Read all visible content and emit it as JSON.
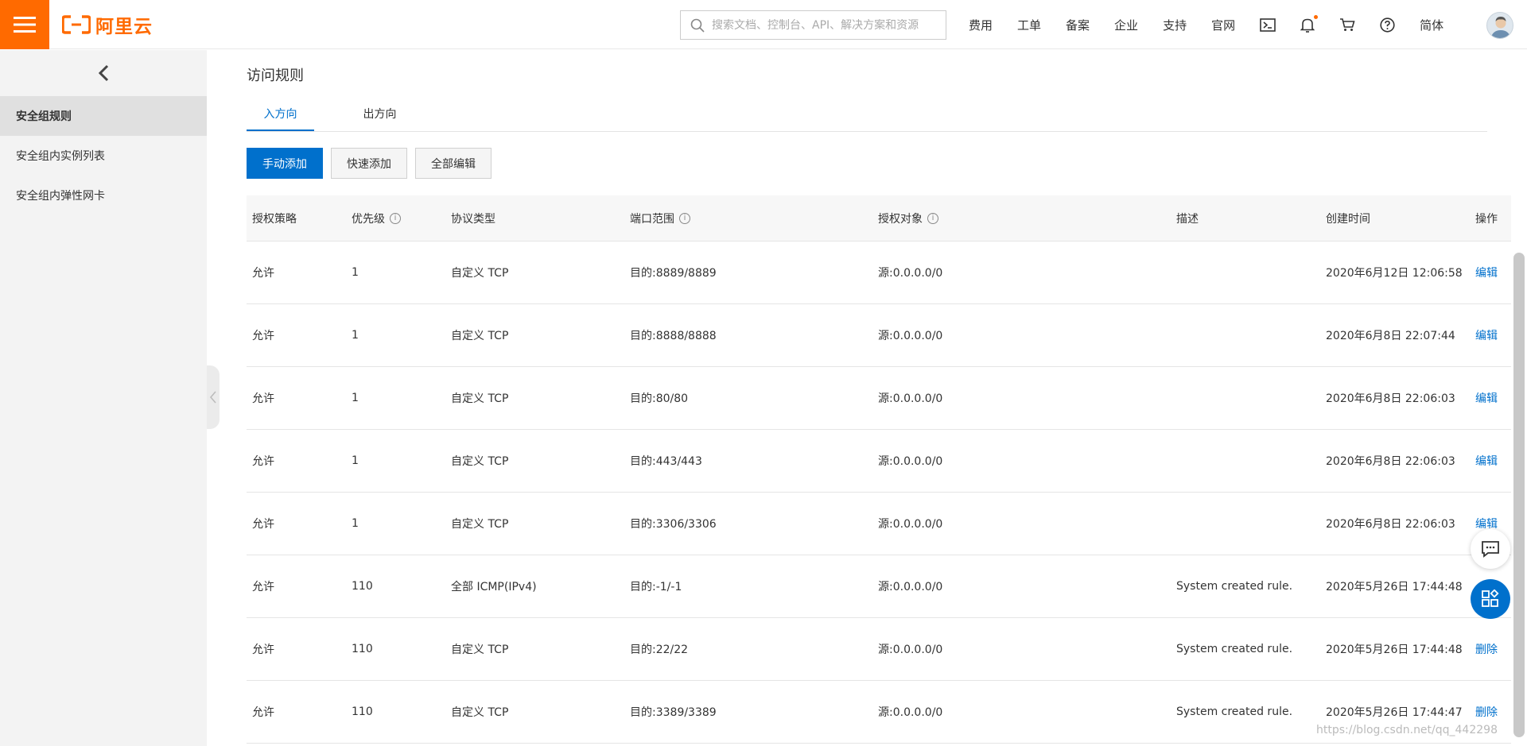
{
  "brand": {
    "logo_text": "阿里云",
    "color": "#ff6a00"
  },
  "search": {
    "placeholder": "搜索文档、控制台、API、解决方案和资源"
  },
  "nav": {
    "items": [
      "费用",
      "工单",
      "备案",
      "企业",
      "支持",
      "官网"
    ],
    "language": "简体",
    "icons": [
      "terminal-icon",
      "bell-icon",
      "cart-icon",
      "help-icon"
    ]
  },
  "sidebar": {
    "items": [
      {
        "label": "安全组规则",
        "active": true
      },
      {
        "label": "安全组内实例列表",
        "active": false
      },
      {
        "label": "安全组内弹性网卡",
        "active": false
      }
    ]
  },
  "main": {
    "section_title": "访问规则",
    "tabs": [
      {
        "label": "入方向",
        "active": true
      },
      {
        "label": "出方向",
        "active": false
      }
    ],
    "buttons": {
      "manual_add": "手动添加",
      "quick_add": "快速添加",
      "edit_all": "全部编辑"
    }
  },
  "table": {
    "columns": [
      "授权策略",
      "优先级",
      "协议类型",
      "端口范围",
      "授权对象",
      "描述",
      "创建时间",
      "操作"
    ],
    "rows": [
      {
        "policy": "允许",
        "priority": "1",
        "protocol": "自定义 TCP",
        "port": "目的:8889/8889",
        "source": "源:0.0.0.0/0",
        "desc": "",
        "time": "2020年6月12日 12:06:58",
        "action": "编辑"
      },
      {
        "policy": "允许",
        "priority": "1",
        "protocol": "自定义 TCP",
        "port": "目的:8888/8888",
        "source": "源:0.0.0.0/0",
        "desc": "",
        "time": "2020年6月8日 22:07:44",
        "action": "编辑"
      },
      {
        "policy": "允许",
        "priority": "1",
        "protocol": "自定义 TCP",
        "port": "目的:80/80",
        "source": "源:0.0.0.0/0",
        "desc": "",
        "time": "2020年6月8日 22:06:03",
        "action": "编辑"
      },
      {
        "policy": "允许",
        "priority": "1",
        "protocol": "自定义 TCP",
        "port": "目的:443/443",
        "source": "源:0.0.0.0/0",
        "desc": "",
        "time": "2020年6月8日 22:06:03",
        "action": "编辑"
      },
      {
        "policy": "允许",
        "priority": "1",
        "protocol": "自定义 TCP",
        "port": "目的:3306/3306",
        "source": "源:0.0.0.0/0",
        "desc": "",
        "time": "2020年6月8日 22:06:03",
        "action": "编辑"
      },
      {
        "policy": "允许",
        "priority": "110",
        "protocol": "全部 ICMP(IPv4)",
        "port": "目的:-1/-1",
        "source": "源:0.0.0.0/0",
        "desc": "System created rule.",
        "time": "2020年5月26日 17:44:48",
        "action": ""
      },
      {
        "policy": "允许",
        "priority": "110",
        "protocol": "自定义 TCP",
        "port": "目的:22/22",
        "source": "源:0.0.0.0/0",
        "desc": "System created rule.",
        "time": "2020年5月26日 17:44:48",
        "action": "删除"
      },
      {
        "policy": "允许",
        "priority": "110",
        "protocol": "自定义 TCP",
        "port": "目的:3389/3389",
        "source": "源:0.0.0.0/0",
        "desc": "System created rule.",
        "time": "2020年5月26日 17:44:47",
        "action": "删除"
      }
    ]
  },
  "watermark": "https://blog.csdn.net/qq_442298",
  "colors": {
    "accent": "#0070cc",
    "brand": "#ff6a00"
  }
}
